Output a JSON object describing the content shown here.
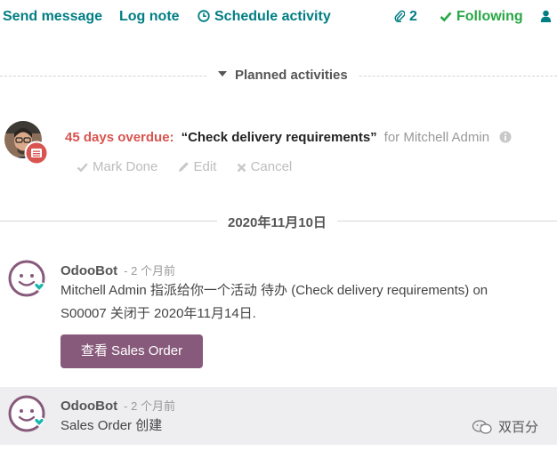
{
  "topbar": {
    "send_message": "Send message",
    "log_note": "Log note",
    "schedule_activity": "Schedule activity",
    "attachment_count": "2",
    "following": "Following"
  },
  "planned": {
    "title": "Planned activities",
    "activity": {
      "overdue": "45 days overdue:",
      "summary": "“Check delivery requirements”",
      "assignee": "for Mitchell Admin",
      "actions": {
        "mark_done": "Mark Done",
        "edit": "Edit",
        "cancel": "Cancel"
      }
    }
  },
  "date_separator": "2020年11月10日",
  "messages": [
    {
      "author": "OdooBot",
      "date": "- 2 个月前",
      "body_line1": "Mitchell Admin 指派给你一个活动 待办 (Check delivery requirements) on",
      "body_line2": "S00007 关闭于 2020年11月14日.",
      "button": "查看 Sales Order"
    },
    {
      "author": "OdooBot",
      "date": "- 2 个月前",
      "body": "Sales Order 创建"
    }
  ],
  "watermark": "双百分",
  "colors": {
    "accent": "#017e84",
    "following": "#28a745",
    "overdue": "#d9534f",
    "primary_button": "#875a7b"
  }
}
